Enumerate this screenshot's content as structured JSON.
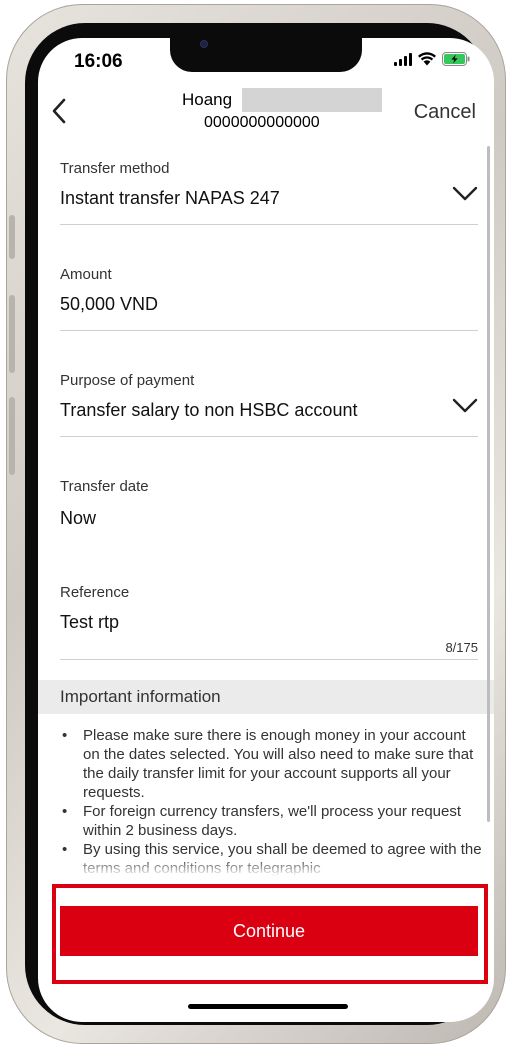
{
  "status_bar": {
    "time": "16:06",
    "signal_icon": "signal-bars-icon",
    "wifi_icon": "wifi-icon",
    "battery_icon": "battery-charging-icon",
    "battery_color": "#34c759"
  },
  "header": {
    "back_icon": "chevron-left-icon",
    "recipient_name": "Hoang",
    "account_number": "0000000000000",
    "cancel_label": "Cancel"
  },
  "form": {
    "transfer_method": {
      "label": "Transfer method",
      "value": "Instant transfer NAPAS 247"
    },
    "amount": {
      "label": "Amount",
      "value": "50,000 VND"
    },
    "purpose": {
      "label": "Purpose of payment",
      "value": "Transfer salary to non HSBC account"
    },
    "transfer_date": {
      "label": "Transfer date",
      "value": "Now"
    },
    "reference": {
      "label": "Reference",
      "value": "Test rtp",
      "counter": "8/175"
    }
  },
  "important_info": {
    "title": "Important information",
    "items": [
      "Please make sure there is enough money in your account on the dates selected. You will also need to make sure that the daily transfer limit for your account supports all your requests.",
      "For foreign currency transfers, we'll process your request within 2 business days.",
      "By using this service, you shall be deemed to agree with the terms and conditions for telegraphic"
    ]
  },
  "actions": {
    "continue_label": "Continue"
  },
  "colors": {
    "brand_red": "#db0011",
    "info_header_bg": "#ebebeb"
  }
}
